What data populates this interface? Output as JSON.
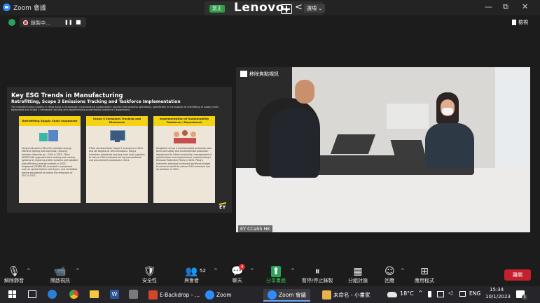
{
  "window": {
    "title": "Zoom 會議",
    "minimize": "—",
    "restore": "⧉",
    "close": "✕"
  },
  "share_bar": {
    "badge": "您正",
    "brand": "Lenovo.",
    "back": "<",
    "dropdown": "選項 ⌄"
  },
  "status_bar": {
    "recording_label": "錄製中...",
    "pause": "❚❚",
    "stop": "■",
    "view_label": "檢視"
  },
  "slide": {
    "title": "Key ESG Trends in Manufacturing",
    "subtitle": "Retrofitting, Scope 3 Emissions Tracking and Taskforce Implementation",
    "intro": "The manufacturing industry in Hong Kong is increasingly incorporating sustainability policies into business operations, specifically in the aspects of retrofitting of supply chain equipment and Scope 3 emissions tracking and implementing sustainability taskforce / department.",
    "columns": [
      {
        "heading": "Retrofitting Supply Chain Equipment",
        "text": "Pang's Industries (39xx.HK) installed energy-efficient lighting and machines, reducing emission intensity by ~20% in 2022. YTech (0283X.HK) upgraded their heating and cooling systems by replacing chiller systems and adopted high-efficiency energy systems in 2022. Kingboard (01888.HK) invested in equipment such as special boilers and dryers, and retrofitted dyeing equipment to reduce the emissions of VOC in 2021."
      },
      {
        "heading": "Scope 3 Emissions Tracking and Disclosure",
        "text": "VTech disclosed their Scope 3 emissions in 2021 and set targets for GHG emissions. Pang's Industries prioritised sourcing from local suppliers to reduce GHG emissions during transportation and procurement processes in 2021."
      },
      {
        "heading": "Implementation of Sustainability Taskforce / Department",
        "text": "Kingboard set up a environmental protection task force and safety and environmental protection department to inform production management of specifications and requirements, implementing a Emission Reduction Policy in 2022. Pang's Industries allocated increased workforce budget to enhance toolkit to reduce GHG emissions and air pollution in 2021."
      }
    ],
    "logo": "EY"
  },
  "video": {
    "speaker_label": "移除焦點視訊",
    "participant_name": "EY CCaSS HK"
  },
  "toolbar": {
    "items": [
      {
        "label": "解除靜音",
        "icon": "microphone-muted-icon",
        "glyph": "🎙"
      },
      {
        "label": "開啟視訊",
        "icon": "video-off-icon",
        "glyph": "📹"
      },
      {
        "label": "安全性",
        "icon": "shield-icon",
        "glyph": "🛡"
      },
      {
        "label": "與會者",
        "icon": "participants-icon",
        "glyph": "👥"
      },
      {
        "label": "聊天",
        "icon": "chat-icon",
        "glyph": "💬"
      },
      {
        "label": "分享畫面",
        "icon": "share-screen-icon",
        "glyph": "⬆"
      },
      {
        "label": "暫停/停止錄製",
        "icon": "record-icon",
        "glyph": "⏸"
      },
      {
        "label": "分組討論",
        "icon": "breakout-icon",
        "glyph": "▦"
      },
      {
        "label": "回應",
        "icon": "reactions-icon",
        "glyph": "☺"
      },
      {
        "label": "應用程式",
        "icon": "apps-icon",
        "glyph": "⊞"
      }
    ],
    "participant_count": "52",
    "chat_badge": "4",
    "leave_label": "離開"
  },
  "taskbar": {
    "apps": [
      {
        "label": "E-Backdrop - ...",
        "color": "#d24726"
      },
      {
        "label": "Zoom",
        "color": "#2d8cff"
      },
      {
        "label": "Zoom 會議",
        "color": "#2d8cff"
      },
      {
        "label": "未命名 - 小畫家",
        "color": "#e8b24a"
      }
    ],
    "weather": "18°C",
    "language": "ENG",
    "time": "15:34",
    "date": "10/1/2023",
    "notifications": "3"
  },
  "colors": {
    "zoom_blue": "#2d8cff",
    "leave_red": "#c5202e",
    "ey_yellow": "#f5d214",
    "share_green": "#2e9d48"
  }
}
